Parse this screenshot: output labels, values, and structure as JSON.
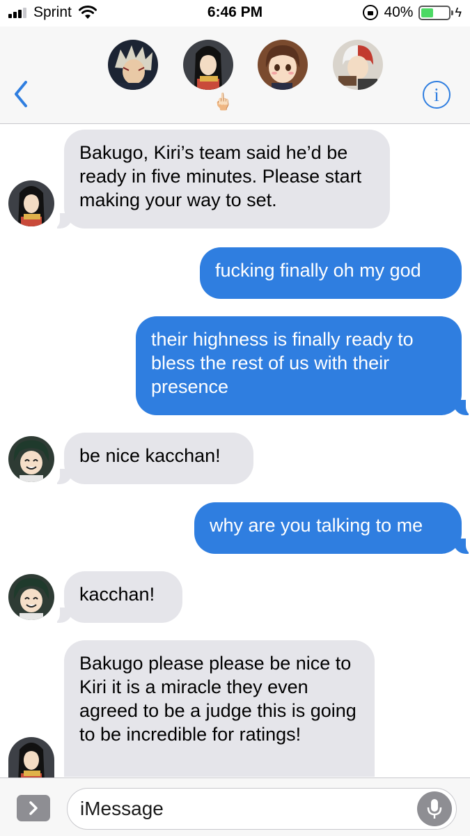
{
  "status_bar": {
    "carrier": "Sprint",
    "time": "6:46 PM",
    "battery_percent": "40%",
    "battery_level": 0.4,
    "icons": [
      "signal-icon",
      "wifi-icon",
      "orientation-lock-icon",
      "battery-icon",
      "charging-bolt-icon"
    ]
  },
  "header": {
    "back_icon": "chevron-left-icon",
    "info_icon": "info-icon",
    "info_glyph": "i",
    "participants": [
      {
        "name": "Bakugo"
      },
      {
        "name": "Yaomomo"
      },
      {
        "name": "Uraraka"
      },
      {
        "name": "Todoroki"
      }
    ],
    "emoji": "🖕🏻"
  },
  "messages": [
    {
      "direction": "in",
      "sender": "Yaomomo",
      "text": "Bakugo, Kiri’s team said he’d be ready in five minutes. Please start making your way to set."
    },
    {
      "direction": "out",
      "text": "fucking finally oh my god"
    },
    {
      "direction": "out",
      "text": "their highness is finally ready to bless the rest of us with their presence"
    },
    {
      "direction": "in",
      "sender": "Deku",
      "text": "be nice kacchan!"
    },
    {
      "direction": "out",
      "text": "why are you talking to me"
    },
    {
      "direction": "in",
      "sender": "Deku",
      "text": "kacchan!"
    },
    {
      "direction": "in",
      "sender": "Yaomomo",
      "text": "Bakugo please please be nice to Kiri it is a miracle they even agreed to be a judge this is going to be incredible for ratings!"
    }
  ],
  "input_bar": {
    "placeholder": "iMessage",
    "apps_icon": "chevron-right-icon",
    "mic_icon": "microphone-icon"
  },
  "colors": {
    "outgoing_bubble": "#2f7ee0",
    "incoming_bubble": "#e5e5ea",
    "accent": "#2f7ee0",
    "battery": "#4cd964"
  }
}
